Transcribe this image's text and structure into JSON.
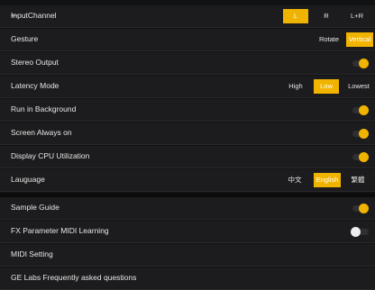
{
  "settings": {
    "input_channel": {
      "label": "InputChannel",
      "options": [
        "L",
        "R",
        "L+R"
      ],
      "selected": "L"
    },
    "gesture": {
      "label": "Gesture",
      "options": [
        "Rotate",
        "Vertical"
      ],
      "selected": "Vertical"
    },
    "stereo_output": {
      "label": "Stereo Output",
      "value": true
    },
    "latency_mode": {
      "label": "Latency Mode",
      "options": [
        "High",
        "Low",
        "Lowest"
      ],
      "selected": "Low"
    },
    "run_in_background": {
      "label": "Run in Background",
      "value": true
    },
    "screen_always_on": {
      "label": "Screen Always on",
      "value": true
    },
    "display_cpu": {
      "label": "Display CPU Utilization",
      "value": true
    },
    "language": {
      "label": "Lauguage",
      "options": [
        "中文",
        "English",
        "繁體"
      ],
      "selected": "English"
    }
  },
  "more": {
    "sample_guide": {
      "label": "Sample Guide",
      "value": true
    },
    "fx_midi_learning": {
      "label": "FX Parameter MIDI Learning",
      "value": false
    },
    "midi_setting": {
      "label": "MIDI Setting"
    },
    "faq": {
      "label": "GE Labs Frequently asked questions"
    }
  },
  "colors": {
    "accent": "#f0b400",
    "row_bg": "#1c1c1e",
    "page_bg": "#111214"
  },
  "icons": {
    "back": "back-arrow-icon"
  }
}
